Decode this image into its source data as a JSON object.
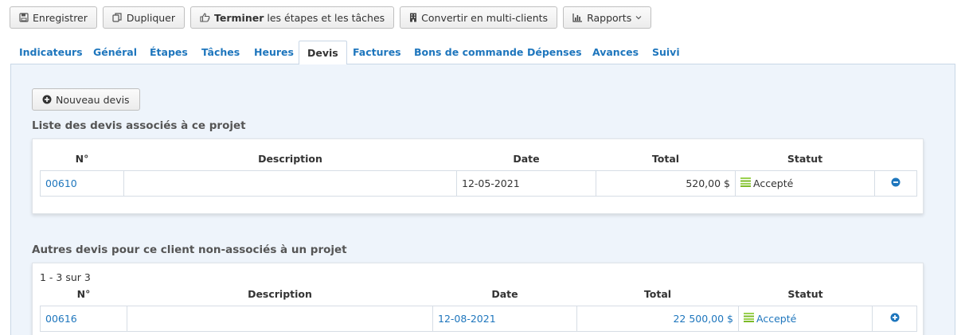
{
  "toolbar": {
    "save": "Enregistrer",
    "duplicate": "Dupliquer",
    "finish_bold": "Terminer",
    "finish_rest": "les étapes et les tâches",
    "convert": "Convertir en multi-clients",
    "reports": "Rapports"
  },
  "tabs": [
    "Indicateurs",
    "Général",
    "Étapes",
    "Tâches",
    "Heures",
    "Devis",
    "Factures",
    "Bons de commande",
    "Dépenses",
    "Avances",
    "Suivi"
  ],
  "active_tab": "Devis",
  "new_quote_button": "Nouveau devis",
  "associated": {
    "title": "Liste des devis associés à ce projet",
    "headers": {
      "number": "N°",
      "description": "Description",
      "date": "Date",
      "total": "Total",
      "status": "Statut"
    },
    "rows": [
      {
        "number": "00610",
        "description": "",
        "date": "12-05-2021",
        "total": "520,00 $",
        "status": "Accepté"
      }
    ]
  },
  "others": {
    "title": "Autres devis pour ce client non-associés à un projet",
    "pager": "1 - 3 sur 3",
    "headers": {
      "number": "N°",
      "description": "Description",
      "date": "Date",
      "total": "Total",
      "status": "Statut"
    },
    "rows": [
      {
        "number": "00616",
        "description": "",
        "date": "12-08-2021",
        "total": "22 500,00 $",
        "status": "Accepté"
      }
    ]
  },
  "colors": {
    "link": "#1e76bd",
    "panel_bg": "#eef4fb",
    "status_green": "#7dbb28"
  }
}
